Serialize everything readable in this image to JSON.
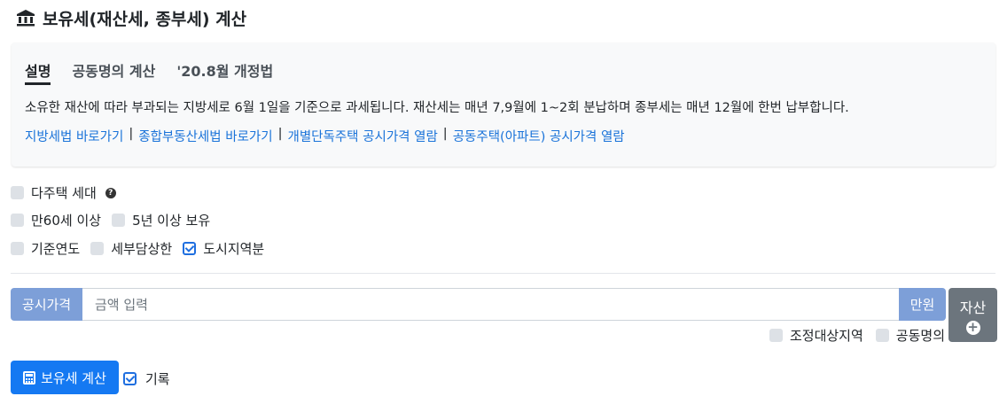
{
  "header": {
    "title": "보유세(재산세, 종부세) 계산",
    "icon": "bank-icon"
  },
  "info": {
    "tabs": [
      {
        "label": "설명",
        "active": true
      },
      {
        "label": "공동명의 계산",
        "active": false
      },
      {
        "label": "'20.8월 개정법",
        "active": false
      }
    ],
    "description": "소유한 재산에 따라 부과되는 지방세로 6월 1일을 기준으로 과세됩니다. 재산세는 매년 7,9월에 1~2회 분납하며 종부세는 매년 12월에 한번 납부합니다.",
    "links": [
      "지방세법 바로가기",
      "종합부동산세법 바로가기",
      "개별단독주택 공시가격 열람",
      "공동주택(아파트) 공시가격 열람"
    ],
    "separator": "|"
  },
  "options": {
    "multi_house": {
      "label": "다주택 세대",
      "checked": false,
      "icon": "question-circle-icon"
    },
    "age60": {
      "label": "만60세 이상",
      "checked": false
    },
    "own5y": {
      "label": "5년 이상 보유",
      "checked": false
    },
    "base_year": {
      "label": "기준연도",
      "checked": false
    },
    "tax_limit": {
      "label": "세부담상한",
      "checked": false
    },
    "urban_area": {
      "label": "도시지역분",
      "checked": true
    }
  },
  "price": {
    "label": "공시가격",
    "placeholder": "금액 입력",
    "value": "",
    "unit": "만원"
  },
  "asset_button": {
    "label": "자산",
    "icon": "plus-circle-icon"
  },
  "sub_options": {
    "adjusted_area": {
      "label": "조정대상지역",
      "checked": false
    },
    "joint_owner": {
      "label": "공동명의",
      "checked": false
    }
  },
  "calc_button": {
    "label": "보유세 계산",
    "icon": "calculator-icon"
  },
  "record": {
    "label": "기록",
    "checked": true
  },
  "colors": {
    "primary": "#1579f2",
    "link": "#1a73d9",
    "addon": "#7d9fd8",
    "secondary": "#6c757d",
    "card_bg": "#f8f9fa"
  }
}
